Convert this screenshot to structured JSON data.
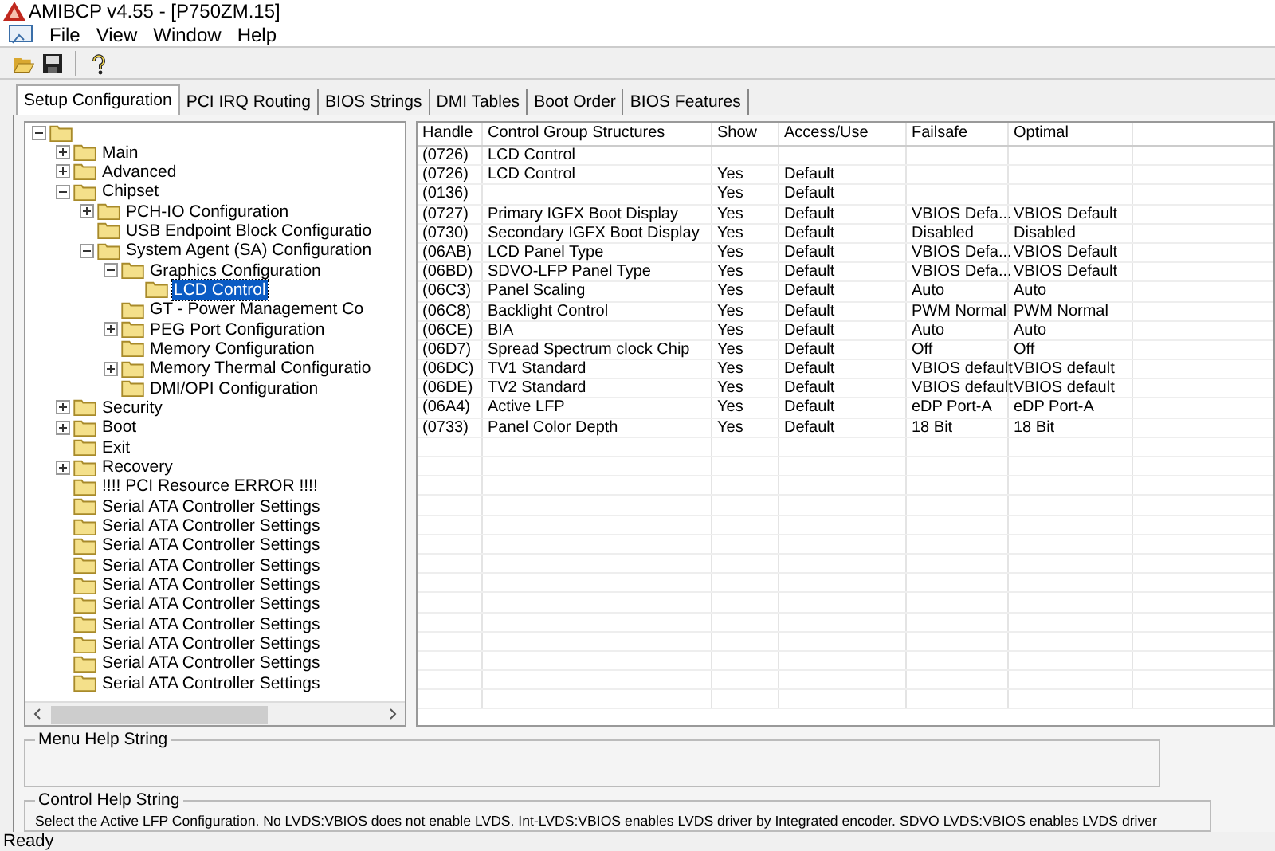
{
  "window": {
    "title": "AMIBCP v4.55 - [P750ZM.15]"
  },
  "menu": [
    "File",
    "View",
    "Window",
    "Help"
  ],
  "tabs": [
    {
      "label": "Setup Configuration",
      "selected": true
    },
    {
      "label": "PCI IRQ Routing",
      "selected": false
    },
    {
      "label": "BIOS Strings",
      "selected": false
    },
    {
      "label": "DMI Tables",
      "selected": false
    },
    {
      "label": "Boot Order",
      "selected": false
    },
    {
      "label": "BIOS Features",
      "selected": false
    }
  ],
  "tree": {
    "expanded": true,
    "children": [
      {
        "label": "Main",
        "expanded": false,
        "selected": false
      },
      {
        "label": "Advanced",
        "expanded": false,
        "selected": false
      },
      {
        "label": "Chipset",
        "expanded": true,
        "selected": false,
        "children": [
          {
            "label": "PCH-IO Configuration",
            "expanded": false,
            "selected": false
          },
          {
            "label": "USB Endpoint Block Configuratio",
            "selected": false
          },
          {
            "label": "System Agent (SA) Configuration",
            "expanded": true,
            "selected": false,
            "children": [
              {
                "label": "Graphics Configuration",
                "expanded": true,
                "selected": false,
                "children": [
                  {
                    "label": "LCD Control",
                    "selected": true
                  }
                ]
              },
              {
                "label": "GT - Power Management Co",
                "selected": false
              },
              {
                "label": "PEG Port Configuration",
                "expanded": false,
                "selected": false
              },
              {
                "label": "Memory Configuration",
                "selected": false
              },
              {
                "label": "Memory Thermal Configuratio",
                "expanded": false,
                "selected": false
              },
              {
                "label": "DMI/OPI Configuration",
                "selected": false
              }
            ]
          }
        ]
      },
      {
        "label": "Security",
        "expanded": false,
        "selected": false
      },
      {
        "label": "Boot",
        "expanded": false,
        "selected": false
      },
      {
        "label": "Exit",
        "selected": false
      },
      {
        "label": "Recovery",
        "expanded": false,
        "selected": false
      },
      {
        "label": "!!!! PCI Resource ERROR !!!!",
        "selected": false
      },
      {
        "label": "Serial ATA Controller Settings",
        "selected": false
      },
      {
        "label": "Serial ATA Controller Settings",
        "selected": false
      },
      {
        "label": "Serial ATA Controller Settings",
        "selected": false
      },
      {
        "label": "Serial ATA Controller Settings",
        "selected": false
      },
      {
        "label": "Serial ATA Controller Settings",
        "selected": false
      },
      {
        "label": "Serial ATA Controller Settings",
        "selected": false
      },
      {
        "label": "Serial ATA Controller Settings",
        "selected": false
      },
      {
        "label": "Serial ATA Controller Settings",
        "selected": false
      },
      {
        "label": "Serial ATA Controller Settings",
        "selected": false
      },
      {
        "label": "Serial ATA Controller Settings",
        "selected": false
      }
    ]
  },
  "table": {
    "columns": [
      "Handle",
      "Control Group Structures",
      "Show",
      "Access/Use",
      "Failsafe",
      "Optimal"
    ],
    "rows": [
      {
        "handle": "(0726)",
        "name": "LCD Control"
      },
      {
        "handle": "(0726)",
        "name": "LCD Control",
        "show": "Yes",
        "access": "Default"
      },
      {
        "handle": "(0136)",
        "show": "Yes",
        "access": "Default"
      },
      {
        "handle": "(0727)",
        "name": "Primary IGFX Boot Display",
        "show": "Yes",
        "access": "Default",
        "failsafe": "VBIOS Defa...",
        "optimal": "VBIOS Default"
      },
      {
        "handle": "(0730)",
        "name": "Secondary IGFX Boot Display",
        "show": "Yes",
        "access": "Default",
        "failsafe": "Disabled",
        "optimal": "Disabled"
      },
      {
        "handle": "(06AB)",
        "name": "LCD Panel Type",
        "show": "Yes",
        "access": "Default",
        "failsafe": "VBIOS Defa...",
        "optimal": "VBIOS Default"
      },
      {
        "handle": "(06BD)",
        "name": "SDVO-LFP Panel Type",
        "show": "Yes",
        "access": "Default",
        "failsafe": "VBIOS Defa...",
        "optimal": "VBIOS Default"
      },
      {
        "handle": "(06C3)",
        "name": "Panel Scaling",
        "show": "Yes",
        "access": "Default",
        "failsafe": "Auto",
        "optimal": "Auto"
      },
      {
        "handle": "(06C8)",
        "name": "Backlight Control",
        "show": "Yes",
        "access": "Default",
        "failsafe": "PWM Normal",
        "optimal": "PWM Normal"
      },
      {
        "handle": "(06CE)",
        "name": "BIA",
        "show": "Yes",
        "access": "Default",
        "failsafe": "Auto",
        "optimal": "Auto"
      },
      {
        "handle": "(06D7)",
        "name": "Spread Spectrum clock Chip",
        "show": "Yes",
        "access": "Default",
        "failsafe": "Off",
        "optimal": "Off"
      },
      {
        "handle": "(06DC)",
        "name": "TV1 Standard",
        "show": "Yes",
        "access": "Default",
        "failsafe": "VBIOS default",
        "optimal": "VBIOS default"
      },
      {
        "handle": "(06DE)",
        "name": "TV2 Standard",
        "show": "Yes",
        "access": "Default",
        "failsafe": "VBIOS default",
        "optimal": "VBIOS default"
      },
      {
        "handle": "(06A4)",
        "name": "Active LFP",
        "show": "Yes",
        "access": "Default",
        "failsafe": "eDP Port-A",
        "optimal": "eDP Port-A"
      },
      {
        "handle": "(0733)",
        "name": "Panel Color Depth",
        "show": "Yes",
        "access": "Default",
        "failsafe": "18 Bit",
        "optimal": "18 Bit"
      }
    ]
  },
  "menu_help": {
    "title": "Menu Help String"
  },
  "control_help": {
    "title": "Control Help String",
    "text": "Select the Active LFP Configuration.    No LVDS:VBIOS does not enable LVDS.   Int-LVDS:VBIOS enables LVDS driver by Integrated encoder.   SDVO LVDS:VBIOS enables LVDS driver"
  },
  "status_bar": {
    "text": "Ready"
  }
}
